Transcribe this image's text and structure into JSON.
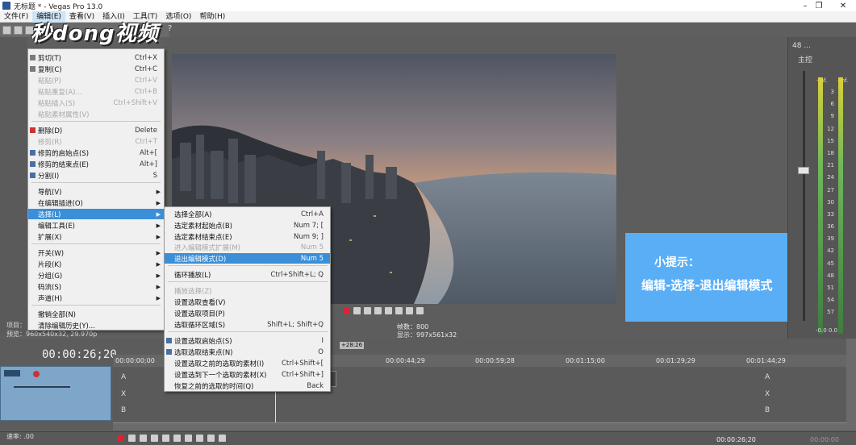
{
  "window": {
    "title": "无标题 * - Vegas Pro 13.0",
    "minimize": "–",
    "maximize": "❐",
    "close": "✕"
  },
  "menubar": [
    {
      "label": "文件(F)"
    },
    {
      "label": "编辑(E)",
      "active": true
    },
    {
      "label": "查看(V)"
    },
    {
      "label": "插入(I)"
    },
    {
      "label": "工具(T)"
    },
    {
      "label": "选项(O)"
    },
    {
      "label": "帮助(H)"
    }
  ],
  "logo": {
    "text": "秒dong视频"
  },
  "edit_menu": {
    "items": [
      {
        "label": "剪切(T)",
        "shortcut": "Ctrl+X",
        "disabled": false
      },
      {
        "label": "复制(C)",
        "shortcut": "Ctrl+C",
        "disabled": false
      },
      {
        "label": "粘贴(P)",
        "shortcut": "Ctrl+V",
        "disabled": true
      },
      {
        "label": "粘贴重复(A)...",
        "shortcut": "Ctrl+B",
        "disabled": true
      },
      {
        "label": "粘贴插入(S)",
        "shortcut": "Ctrl+Shift+V",
        "disabled": true
      },
      {
        "label": "粘贴素材属性(V)",
        "shortcut": "",
        "disabled": true
      },
      {
        "label": "删除(D)",
        "shortcut": "Delete",
        "disabled": false
      },
      {
        "label": "修剪(R)",
        "shortcut": "Ctrl+T",
        "disabled": true
      },
      {
        "label": "修剪的启始点(S)",
        "shortcut": "Alt+[",
        "disabled": false
      },
      {
        "label": "修剪的结束点(E)",
        "shortcut": "Alt+]",
        "disabled": false
      },
      {
        "label": "分割(I)",
        "shortcut": "S",
        "disabled": false
      },
      {
        "label": "导航(V)",
        "submenu": true
      },
      {
        "label": "在编辑插进(O)",
        "submenu": true
      },
      {
        "label": "选择(L)",
        "submenu": true,
        "highlighted": true
      },
      {
        "label": "编辑工具(E)",
        "submenu": true
      },
      {
        "label": "扩展(X)",
        "submenu": true
      },
      {
        "label": "开关(W)",
        "submenu": true
      },
      {
        "label": "片段(K)",
        "submenu": true
      },
      {
        "label": "分组(G)",
        "submenu": true
      },
      {
        "label": "码流(S)",
        "submenu": true
      },
      {
        "label": "声道(H)",
        "submenu": true
      },
      {
        "label": "撤销全部(N)",
        "shortcut": ""
      },
      {
        "label": "清除编辑历史(Y)...",
        "shortcut": ""
      }
    ]
  },
  "select_submenu": {
    "items": [
      {
        "label": "选择全部(A)",
        "shortcut": "Ctrl+A",
        "disabled": false
      },
      {
        "label": "选定素材起始点(B)",
        "shortcut": "Num 7; [",
        "disabled": false
      },
      {
        "label": "选定素材结束点(E)",
        "shortcut": "Num 9; ]",
        "disabled": false
      },
      {
        "label": "进入编辑模式扩展(M)",
        "shortcut": "Num 5",
        "disabled": true
      },
      {
        "label": "退出编辑模式(D)",
        "shortcut": "Num 5",
        "disabled": false,
        "highlighted": true
      },
      {
        "label": "循环播放(L)",
        "shortcut": "Ctrl+Shift+L; Q",
        "disabled": false
      },
      {
        "label": "播放选择(Z)",
        "shortcut": "",
        "disabled": true
      },
      {
        "label": "设置选取查看(V)",
        "shortcut": "",
        "disabled": false
      },
      {
        "label": "设置选取项目(P)",
        "shortcut": "",
        "disabled": false
      },
      {
        "label": "选取循环区域(S)",
        "shortcut": "Shift+L; Shift+Q",
        "disabled": false
      },
      {
        "label": "设置选取启始点(S)",
        "shortcut": "I",
        "disabled": false
      },
      {
        "label": "选取选取结束点(N)",
        "shortcut": "O",
        "disabled": false
      },
      {
        "label": "设置选取之前的选取的素材(I)",
        "shortcut": "Ctrl+Shift+[",
        "disabled": false
      },
      {
        "label": "设置选到下一个选取的素材(X)",
        "shortcut": "Ctrl+Shift+]",
        "disabled": false
      },
      {
        "label": "恢复之前的选取的时间(Q)",
        "shortcut": "Back",
        "disabled": false
      }
    ]
  },
  "tip": {
    "title": "小提示：",
    "body": "编辑-选择-退出编辑模式"
  },
  "preview": {
    "frame": "帧数：800",
    "display": "显示：997x561x32",
    "project": "项目：",
    "preview_info": "预览：960x540x32, 29.970p"
  },
  "mixer": {
    "top": "48 ...",
    "label": "主控",
    "inf_left": "-Inf.",
    "inf_right": "-Inf.",
    "scale": [
      "3",
      "6",
      "9",
      "12",
      "15",
      "18",
      "21",
      "24",
      "27",
      "30",
      "33",
      "36",
      "39",
      "42",
      "45",
      "48",
      "51",
      "54",
      "57"
    ],
    "bottom": "-0.0   0.0"
  },
  "timeline": {
    "timecode": "00:00:26;20",
    "marker": "+28:26",
    "ruler": [
      "00:00:00;00",
      "00:00:44;29",
      "00:00:59;28",
      "00:01:15;00",
      "00:01:29;29",
      "00:01:44;29"
    ],
    "lane_a": "A",
    "lane_x": "X",
    "lane_b": "B"
  },
  "bottom": {
    "rate": "速率: .00",
    "time": "00:00:26;20",
    "time2": "00:00:00"
  },
  "colors": {
    "highlight": "#3a8fd8",
    "tip_bg": "#5aaef6"
  }
}
